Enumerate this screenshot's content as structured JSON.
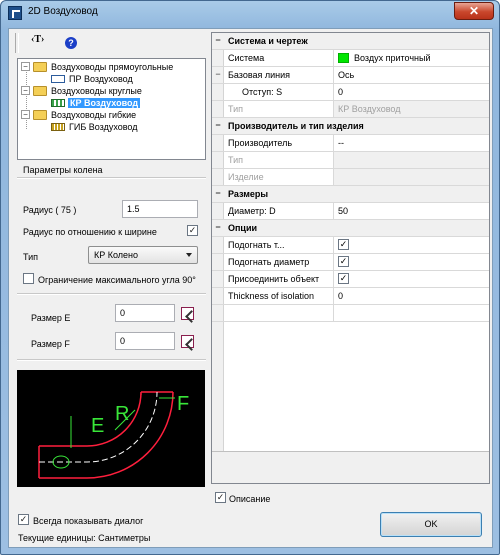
{
  "window": {
    "title": "2D Воздуховод",
    "close_glyph": "✕"
  },
  "toolbar": {
    "text_button": "‹T›",
    "help_glyph": "?"
  },
  "tree": {
    "folders": [
      {
        "label": "Воздуховоды прямоугольные",
        "child": "ПР Воздуховод"
      },
      {
        "label": "Воздуховоды круглые",
        "child": "КР Воздуховод"
      },
      {
        "label": "Воздуховоды гибкие",
        "child": "ГИБ Воздуховод"
      }
    ],
    "expander_glyph": "−"
  },
  "params": {
    "group_title": "Параметры колена",
    "radius_label": "Радиус ( 75 )",
    "radius_value": "1.5",
    "radius_ratio_label": "Радиус по отношению к ширине",
    "radius_ratio_checked": true,
    "type_label": "Тип",
    "type_value": "КР Колено",
    "limit_angle_label": "Ограничение максимального угла 90°",
    "limit_angle_checked": false,
    "size_e_label": "Размер E",
    "size_e_value": "0",
    "size_f_label": "Размер F",
    "size_f_value": "0"
  },
  "preview": {
    "label_e": "E",
    "label_r": "R",
    "label_f": "F"
  },
  "grid": {
    "rows": [
      {
        "type": "cat",
        "name": "Система и чертеж",
        "toggle": "−"
      },
      {
        "type": "prop",
        "name": "Система",
        "value": "Воздух приточный",
        "swatch": "#00e600"
      },
      {
        "type": "prop",
        "name": "Базовая линия",
        "value": "Ось",
        "toggle": "−"
      },
      {
        "type": "prop",
        "name": "Отступ: S",
        "value": "0",
        "indent": true
      },
      {
        "type": "disabled",
        "name": "Тип",
        "value": "КР Воздуховод"
      },
      {
        "type": "cat",
        "name": "Производитель и тип изделия",
        "toggle": "−"
      },
      {
        "type": "prop",
        "name": "Производитель",
        "value": "--"
      },
      {
        "type": "disabled",
        "name": "Тип",
        "value": ""
      },
      {
        "type": "disabled",
        "name": "Изделие",
        "value": ""
      },
      {
        "type": "cat",
        "name": "Размеры",
        "toggle": "−"
      },
      {
        "type": "prop",
        "name": "Диаметр: D",
        "value": "50"
      },
      {
        "type": "cat",
        "name": "Опции",
        "toggle": "−"
      },
      {
        "type": "check",
        "name": "Подогнать т...",
        "checked": true
      },
      {
        "type": "check",
        "name": "Подогнать диаметр",
        "checked": true
      },
      {
        "type": "check",
        "name": "Присоединить объект",
        "checked": true
      },
      {
        "type": "prop",
        "name": "Thickness of isolation",
        "value": "0"
      }
    ]
  },
  "footer": {
    "description_label": "Описание",
    "description_checked": true,
    "always_show_label": "Всегда показывать диалог",
    "always_show_checked": true,
    "units_label": "Текущие единицы: Сантиметры",
    "ok_label": "OK",
    "check_glyph": "✓"
  }
}
